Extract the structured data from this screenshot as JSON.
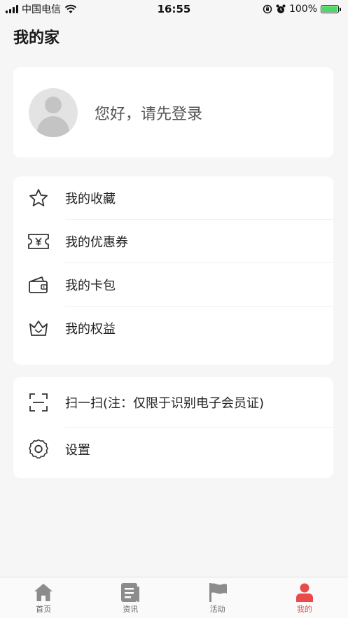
{
  "status_bar": {
    "carrier": "中国电信",
    "time": "16:55",
    "battery": "100%"
  },
  "page": {
    "title": "我的家"
  },
  "profile": {
    "login_prompt": "您好，请先登录"
  },
  "menu_group_1": [
    {
      "label": "我的收藏",
      "icon": "star-icon"
    },
    {
      "label": "我的优惠券",
      "icon": "coupon-icon"
    },
    {
      "label": "我的卡包",
      "icon": "wallet-icon"
    },
    {
      "label": "我的权益",
      "icon": "crown-icon"
    }
  ],
  "menu_group_2": [
    {
      "label": "扫一扫(注：仅限于识别电子会员证)",
      "icon": "scan-icon"
    },
    {
      "label": "设置",
      "icon": "gear-icon"
    }
  ],
  "tab_bar": {
    "tabs": [
      {
        "label": "首页",
        "icon": "home-icon"
      },
      {
        "label": "资讯",
        "icon": "news-icon"
      },
      {
        "label": "活动",
        "icon": "flag-icon"
      },
      {
        "label": "我的",
        "icon": "person-icon",
        "active": true
      }
    ],
    "active_color": "#e94b4b",
    "inactive_color": "#8c8c8c"
  }
}
